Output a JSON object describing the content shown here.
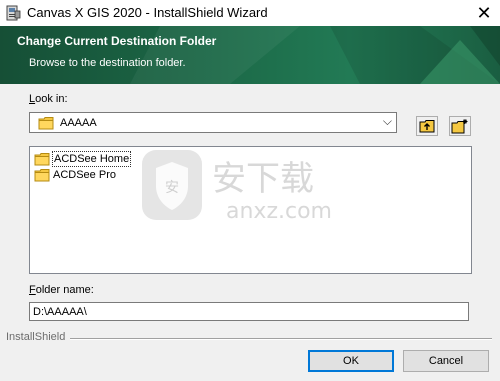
{
  "window": {
    "title": "Canvas X GIS 2020 - InstallShield Wizard",
    "close_glyph": "✕"
  },
  "banner": {
    "title": "Change Current Destination Folder",
    "subtitle": "Browse to the destination folder.",
    "bg_color": "#1c6a48"
  },
  "look_in": {
    "label": "Look in:",
    "value": "AAAAA",
    "chevron": "⌵"
  },
  "toolbar": {
    "up_folder_icon": "up-folder-icon",
    "new_folder_icon": "new-folder-icon"
  },
  "folders": [
    {
      "name": "ACDSee Home",
      "selected": true
    },
    {
      "name": "ACDSee Pro",
      "selected": false
    }
  ],
  "folder_name": {
    "label": "Folder name:",
    "value": "D:\\AAAAA\\"
  },
  "footer": {
    "brand": "InstallShield",
    "ok_label": "OK",
    "cancel_label": "Cancel"
  },
  "watermark": {
    "text_cn": "安下载",
    "text_en": "anxz.com"
  },
  "colors": {
    "accent": "#0078d7",
    "folder": "#f5c842"
  }
}
